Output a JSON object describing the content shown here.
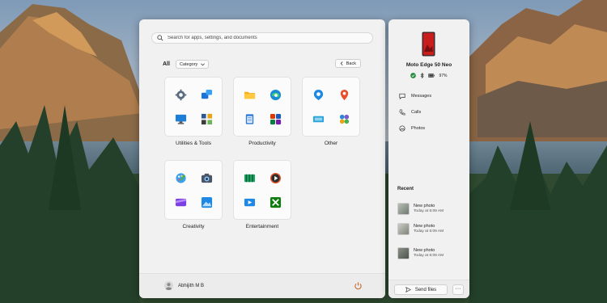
{
  "search": {
    "placeholder": "Search for apps, settings, and documents",
    "icon": "search-icon"
  },
  "filter": {
    "all_label": "All",
    "category_label": "Category",
    "back_label": "Back"
  },
  "folders": [
    {
      "label": "Utilities & Tools",
      "apps": [
        "settings-app-icon",
        "phone-link-app-icon",
        "remote-desktop-app-icon",
        "task-manager-app-icon"
      ]
    },
    {
      "label": "Productivity",
      "apps": [
        "file-explorer-app-icon",
        "edge-app-icon",
        "notepad-app-icon",
        "office-app-icon"
      ]
    },
    {
      "label": "Other",
      "apps": [
        "get-help-app-icon",
        "maps-app-icon",
        "mobile-devices-app-icon",
        "family-app-icon"
      ]
    },
    {
      "label": "Creativity",
      "apps": [
        "paint-app-icon",
        "camera-app-icon",
        "clipchamp-app-icon",
        "photos-app-icon"
      ]
    },
    {
      "label": "Entertainment",
      "apps": [
        "movies-tv-app-icon",
        "media-player-app-icon",
        "video-editor-app-icon",
        "xbox-app-icon"
      ]
    }
  ],
  "footer": {
    "user_name": "Abhijith M B"
  },
  "phone": {
    "device_name": "Moto Edge 50 Neo",
    "battery": "97%",
    "nav": [
      {
        "label": "Messages",
        "icon": "messages-icon"
      },
      {
        "label": "Calls",
        "icon": "calls-icon"
      },
      {
        "label": "Photos",
        "icon": "photos-icon"
      }
    ],
    "recent_title": "Recent",
    "recent": [
      {
        "title": "New photo",
        "subtitle": "Today at 6:09 AM"
      },
      {
        "title": "New photo",
        "subtitle": "Today at 6:09 AM"
      },
      {
        "title": "New photo",
        "subtitle": "Today at 6:09 AM"
      }
    ],
    "send_files_label": "Send files",
    "more_label": "···"
  },
  "colors": {
    "accent": "#0067c0",
    "phone_red": "#c81e1e",
    "status_green": "#1f8a3a"
  }
}
